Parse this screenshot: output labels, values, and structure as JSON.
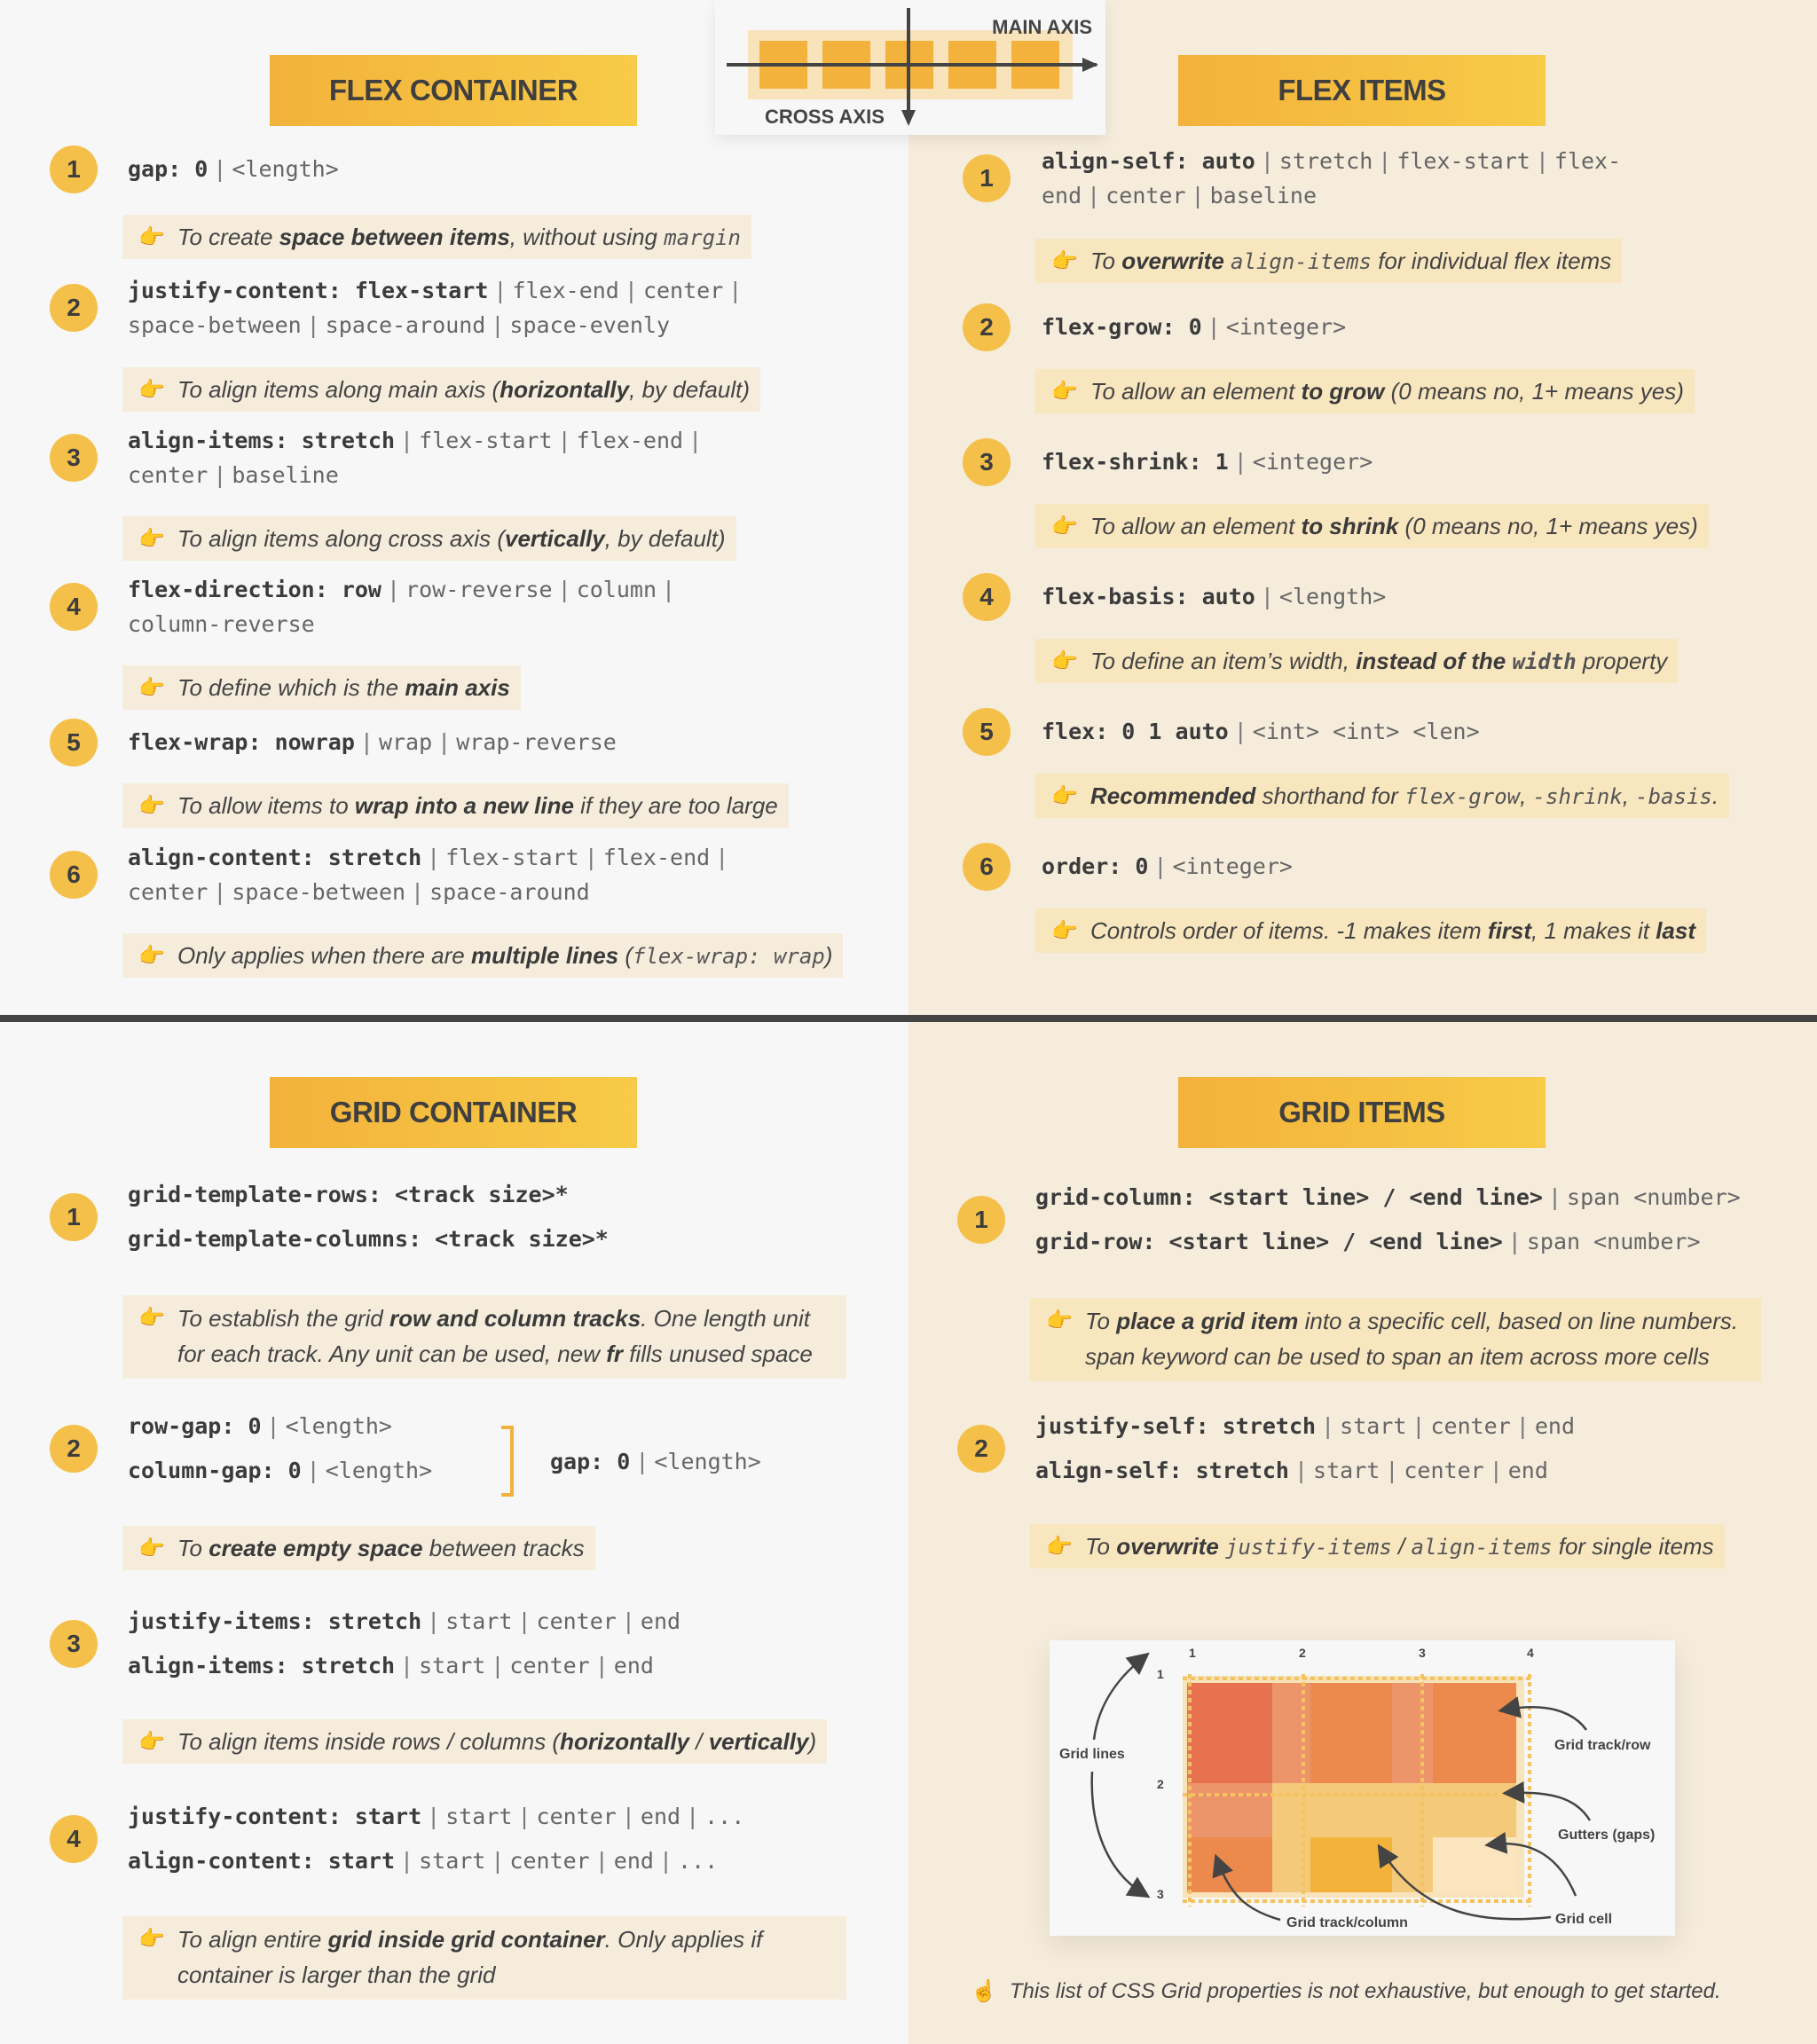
{
  "colors": {
    "heading_gradient_start": "#f3b23b",
    "heading_gradient_end": "#f7cb47",
    "number_badge": "#f4c04a",
    "left_bg": "#f7f7f7",
    "right_bg": "#f5ecdc",
    "divider": "#444444",
    "flex_item": "#f3b23b",
    "flex_container": "#f8e3bb"
  },
  "axis_diagram": {
    "main_axis_label": "MAIN AXIS",
    "cross_axis_label": "CROSS AXIS",
    "item_count": 5
  },
  "flex_container": {
    "title": "FLEX CONTAINER",
    "items": [
      {
        "number": "1",
        "lines": [
          [
            {
              "t": "gap: 0",
              "b": true
            },
            {
              "sep": true
            },
            {
              "t": "<length>"
            }
          ]
        ],
        "note": [
          {
            "t": "To create "
          },
          {
            "t": "space between items",
            "b": true
          },
          {
            "t": ", without using "
          },
          {
            "t": "margin",
            "code": true
          }
        ]
      },
      {
        "number": "2",
        "lines": [
          [
            {
              "t": "justify-content: flex-start",
              "b": true
            },
            {
              "sep": true
            },
            {
              "t": "flex-end"
            },
            {
              "sep": true
            },
            {
              "t": "center"
            },
            {
              "sep": true
            }
          ],
          [
            {
              "t": "space-between"
            },
            {
              "sep": true
            },
            {
              "t": "space-around"
            },
            {
              "sep": true
            },
            {
              "t": "space-evenly"
            }
          ]
        ],
        "note": [
          {
            "t": "To align items along main axis ("
          },
          {
            "t": "horizontally",
            "b": true
          },
          {
            "t": ", by default)"
          }
        ]
      },
      {
        "number": "3",
        "lines": [
          [
            {
              "t": "align-items: stretch",
              "b": true
            },
            {
              "sep": true
            },
            {
              "t": "flex-start"
            },
            {
              "sep": true
            },
            {
              "t": "flex-end"
            },
            {
              "sep": true
            }
          ],
          [
            {
              "t": "center"
            },
            {
              "sep": true
            },
            {
              "t": "baseline"
            }
          ]
        ],
        "note": [
          {
            "t": "To align items along cross axis ("
          },
          {
            "t": "vertically",
            "b": true
          },
          {
            "t": ", by default)"
          }
        ]
      },
      {
        "number": "4",
        "lines": [
          [
            {
              "t": "flex-direction: row",
              "b": true
            },
            {
              "sep": true
            },
            {
              "t": "row-reverse"
            },
            {
              "sep": true
            },
            {
              "t": "column"
            },
            {
              "sep": true
            }
          ],
          [
            {
              "t": "column-reverse"
            }
          ]
        ],
        "note": [
          {
            "t": "To define which is the "
          },
          {
            "t": "main axis",
            "b": true
          }
        ]
      },
      {
        "number": "5",
        "lines": [
          [
            {
              "t": "flex-wrap: nowrap",
              "b": true
            },
            {
              "sep": true
            },
            {
              "t": "wrap"
            },
            {
              "sep": true
            },
            {
              "t": "wrap-reverse"
            }
          ]
        ],
        "note": [
          {
            "t": "To allow items to "
          },
          {
            "t": "wrap into a new line",
            "b": true
          },
          {
            "t": " if they are too large"
          }
        ]
      },
      {
        "number": "6",
        "lines": [
          [
            {
              "t": "align-content: stretch",
              "b": true
            },
            {
              "sep": true
            },
            {
              "t": "flex-start"
            },
            {
              "sep": true
            },
            {
              "t": "flex-end"
            },
            {
              "sep": true
            }
          ],
          [
            {
              "t": "center"
            },
            {
              "sep": true
            },
            {
              "t": "space-between"
            },
            {
              "sep": true
            },
            {
              "t": "space-around"
            }
          ]
        ],
        "note": [
          {
            "t": "Only applies when there are "
          },
          {
            "t": "multiple lines",
            "b": true
          },
          {
            "t": " ("
          },
          {
            "t": "flex-wrap: wrap",
            "code": true
          },
          {
            "t": ")"
          }
        ]
      }
    ]
  },
  "flex_items": {
    "title": "FLEX ITEMS",
    "items": [
      {
        "number": "1",
        "lines": [
          [
            {
              "t": "align-self: auto",
              "b": true
            },
            {
              "sep": true
            },
            {
              "t": "stretch"
            },
            {
              "sep": true
            },
            {
              "t": "flex-start"
            },
            {
              "sep": true
            },
            {
              "t": "flex-"
            }
          ],
          [
            {
              "t": "end"
            },
            {
              "sep": true
            },
            {
              "t": "center"
            },
            {
              "sep": true
            },
            {
              "t": "baseline"
            }
          ]
        ],
        "note": [
          {
            "t": "To "
          },
          {
            "t": "overwrite",
            "b": true
          },
          {
            "t": " "
          },
          {
            "t": "align-items",
            "code": true
          },
          {
            "t": " for individual flex items"
          }
        ]
      },
      {
        "number": "2",
        "lines": [
          [
            {
              "t": "flex-grow: 0",
              "b": true
            },
            {
              "sep": true
            },
            {
              "t": "<integer>"
            }
          ]
        ],
        "note": [
          {
            "t": "To allow an element "
          },
          {
            "t": "to grow",
            "b": true
          },
          {
            "t": " (0 means no, 1+ means yes)"
          }
        ]
      },
      {
        "number": "3",
        "lines": [
          [
            {
              "t": "flex-shrink: 1",
              "b": true
            },
            {
              "sep": true
            },
            {
              "t": "<integer>"
            }
          ]
        ],
        "note": [
          {
            "t": "To allow an element "
          },
          {
            "t": "to shrink",
            "b": true
          },
          {
            "t": " (0 means no, 1+ means yes)"
          }
        ]
      },
      {
        "number": "4",
        "lines": [
          [
            {
              "t": "flex-basis: auto",
              "b": true
            },
            {
              "sep": true
            },
            {
              "t": "<length>"
            }
          ]
        ],
        "note": [
          {
            "t": "To define an item’s width, "
          },
          {
            "t": "instead of the ",
            "b": true
          },
          {
            "t": "width",
            "code": true,
            "b": true
          },
          {
            "t": " property"
          }
        ]
      },
      {
        "number": "5",
        "lines": [
          [
            {
              "t": "flex: 0 1 auto",
              "b": true
            },
            {
              "sep": true
            },
            {
              "t": "<int> <int> <len>"
            }
          ]
        ],
        "note": [
          {
            "t": "Recommended",
            "b": true
          },
          {
            "t": " shorthand for "
          },
          {
            "t": "flex-grow",
            "code": true
          },
          {
            "t": ", "
          },
          {
            "t": "-shrink",
            "code": true
          },
          {
            "t": ", "
          },
          {
            "t": "-basis",
            "code": true
          },
          {
            "t": "."
          }
        ]
      },
      {
        "number": "6",
        "lines": [
          [
            {
              "t": "order: 0",
              "b": true
            },
            {
              "sep": true
            },
            {
              "t": "<integer>"
            }
          ]
        ],
        "note": [
          {
            "t": "Controls order of items. -1 makes item "
          },
          {
            "t": "first",
            "b": true
          },
          {
            "t": ", 1 makes it "
          },
          {
            "t": "last",
            "b": true
          }
        ]
      }
    ]
  },
  "grid_container": {
    "title": "GRID CONTAINER",
    "items": [
      {
        "number": "1",
        "lines": [
          [
            {
              "t": "grid-template-rows: <track size>*",
              "b": true
            }
          ],
          [
            {
              "t": "grid-template-columns: <track size>*",
              "b": true
            }
          ]
        ],
        "note": [
          {
            "t": "To establish the grid "
          },
          {
            "t": "row and column tracks",
            "b": true
          },
          {
            "t": ". One length unit for each track. Any unit can be used, new "
          },
          {
            "t": "fr",
            "b": true
          },
          {
            "t": " fills unused space"
          }
        ]
      },
      {
        "number": "2",
        "lines": [
          [
            {
              "t": "row-gap: 0",
              "b": true
            },
            {
              "sep": true
            },
            {
              "t": "<length>"
            }
          ],
          [
            {
              "t": "column-gap: 0",
              "b": true
            },
            {
              "sep": true
            },
            {
              "t": "<length>"
            }
          ]
        ],
        "shorthand": [
          {
            "t": "gap: 0",
            "b": true
          },
          {
            "sep": true
          },
          {
            "t": "<length>"
          }
        ],
        "note": [
          {
            "t": "To "
          },
          {
            "t": "create empty space",
            "b": true
          },
          {
            "t": " between tracks"
          }
        ]
      },
      {
        "number": "3",
        "lines": [
          [
            {
              "t": "justify-items: stretch",
              "b": true
            },
            {
              "sep": true
            },
            {
              "t": "start"
            },
            {
              "sep": true
            },
            {
              "t": "center"
            },
            {
              "sep": true
            },
            {
              "t": "end"
            }
          ],
          [
            {
              "t": "align-items: stretch",
              "b": true
            },
            {
              "sep": true
            },
            {
              "t": "start"
            },
            {
              "sep": true
            },
            {
              "t": "center"
            },
            {
              "sep": true
            },
            {
              "t": "end"
            }
          ]
        ],
        "note": [
          {
            "t": "To align items inside rows / columns ("
          },
          {
            "t": "horizontally",
            "b": true
          },
          {
            "t": " / "
          },
          {
            "t": "vertically",
            "b": true
          },
          {
            "t": ")"
          }
        ]
      },
      {
        "number": "4",
        "lines": [
          [
            {
              "t": "justify-content: start",
              "b": true
            },
            {
              "sep": true
            },
            {
              "t": "start"
            },
            {
              "sep": true
            },
            {
              "t": "center"
            },
            {
              "sep": true
            },
            {
              "t": "end"
            },
            {
              "sep": true
            },
            {
              "t": "..."
            }
          ],
          [
            {
              "t": "align-content: start",
              "b": true
            },
            {
              "sep": true
            },
            {
              "t": "start"
            },
            {
              "sep": true
            },
            {
              "t": "center"
            },
            {
              "sep": true
            },
            {
              "t": "end"
            },
            {
              "sep": true
            },
            {
              "t": "..."
            }
          ]
        ],
        "note": [
          {
            "t": "To align entire "
          },
          {
            "t": "grid inside grid container",
            "b": true
          },
          {
            "t": ". Only applies if container is larger than the grid"
          }
        ]
      }
    ]
  },
  "grid_items": {
    "title": "GRID ITEMS",
    "items": [
      {
        "number": "1",
        "lines": [
          [
            {
              "t": "grid-column: <start line> / <end line>",
              "b": true
            },
            {
              "sep": true
            },
            {
              "t": "span <number>"
            }
          ],
          [
            {
              "t": "grid-row: <start line> / <end line>",
              "b": true
            },
            {
              "sep": true
            },
            {
              "t": "span <number>"
            }
          ]
        ],
        "note": [
          {
            "t": "To "
          },
          {
            "t": "place a grid item",
            "b": true
          },
          {
            "t": " into a specific cell, based on line numbers. "
          },
          {
            "t": "span",
            "code": false
          },
          {
            "t": " keyword can be used to span an item across more cells"
          }
        ]
      },
      {
        "number": "2",
        "lines": [
          [
            {
              "t": "justify-self: stretch",
              "b": true
            },
            {
              "sep": true
            },
            {
              "t": "start"
            },
            {
              "sep": true
            },
            {
              "t": "center"
            },
            {
              "sep": true
            },
            {
              "t": "end"
            }
          ],
          [
            {
              "t": "align-self: stretch",
              "b": true
            },
            {
              "sep": true
            },
            {
              "t": "start"
            },
            {
              "sep": true
            },
            {
              "t": "center"
            },
            {
              "sep": true
            },
            {
              "t": "end"
            }
          ]
        ],
        "note": [
          {
            "t": "To "
          },
          {
            "t": "overwrite",
            "b": true
          },
          {
            "t": " "
          },
          {
            "t": "justify-items",
            "code": true
          },
          {
            "t": " / "
          },
          {
            "t": "align-items",
            "code": true
          },
          {
            "t": " for single items"
          }
        ]
      }
    ],
    "diagram": {
      "column_line_numbers": [
        "1",
        "2",
        "3",
        "4"
      ],
      "row_line_numbers": [
        "1",
        "2",
        "3"
      ],
      "labels": {
        "grid_lines": "Grid lines",
        "track_row": "Grid track/row",
        "gutters": "Gutters (gaps)",
        "track_column": "Grid track/column",
        "cell": "Grid cell"
      }
    },
    "footer": "This list of CSS Grid properties is not exhaustive, but enough to get started."
  },
  "icons": {
    "pointing_hand": "👉",
    "pointing_up": "☝"
  }
}
